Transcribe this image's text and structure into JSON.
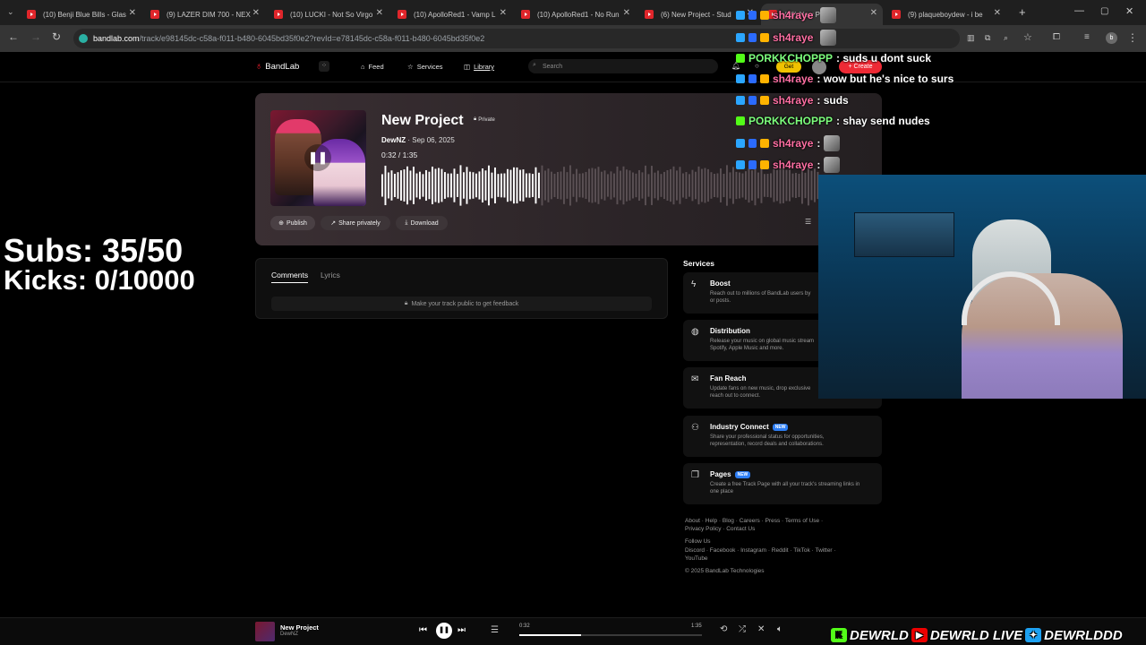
{
  "tabs": [
    {
      "label": "(10) Benji Blue Bills - Glas"
    },
    {
      "label": "(9) LAZER DIM 700 - NEX"
    },
    {
      "label": "(10) LUCKI - Not So Virgo"
    },
    {
      "label": "(10) ApolloRed1 - Vamp L"
    },
    {
      "label": "(10) ApolloRed1 - No Run"
    },
    {
      "label": "(6) New Project - Stud"
    },
    {
      "label": "(10) New Pro"
    },
    {
      "label": "(9) plaqueboydew - i be"
    }
  ],
  "address": {
    "domain": "bandlab.com",
    "path": "/track/e98145dc-c58a-f011-b480-6045bd35f0e2?revId=e78145dc-c58a-f011-b480-6045bd35f0e2"
  },
  "nav": {
    "logo": "BandLab",
    "feed": "Feed",
    "services": "Services",
    "library": "Library",
    "search_placeholder": "Search",
    "get": "Get",
    "create": "+ Create"
  },
  "track": {
    "title": "New Project",
    "privacy": "Private",
    "artist": "DewNZ",
    "date": "Sep 06, 2025",
    "time": "0:32 /  1:35",
    "progress": 0.34,
    "publish": "Publish",
    "share": "Share privately",
    "download": "Download"
  },
  "tabs_panel": {
    "comments": "Comments",
    "lyrics": "Lyrics",
    "notice": "Make your track public to get feedback"
  },
  "services": {
    "heading": "Services",
    "items": [
      {
        "title": "Boost",
        "desc": "Reach out to millions of BandLab users by",
        "desc2": "or posts.",
        "new": false,
        "icon": "bolt-icon"
      },
      {
        "title": "Distribution",
        "desc": "Release your music on global music stream",
        "desc2": "Spotify, Apple Music and more.",
        "new": false,
        "icon": "globe-icon"
      },
      {
        "title": "Fan Reach",
        "desc": "Update fans on new music, drop exclusive",
        "desc2": "reach out to connect.",
        "new": false,
        "icon": "mail-icon"
      },
      {
        "title": "Industry Connect",
        "desc": "Share your professional status for opportunities,",
        "desc2": "representation, record deals and collaborations.",
        "new": true,
        "icon": "people-icon"
      },
      {
        "title": "Pages",
        "desc": "Create a free Track Page with all your track's streaming links in",
        "desc2": "one place",
        "new": true,
        "icon": "pages-icon"
      }
    ],
    "new_label": "NEW"
  },
  "footer": {
    "links1": "About · Help · Blog · Careers · Press · Terms of Use ·",
    "links2": "Privacy Policy · Contact Us",
    "follow": "Follow Us",
    "social1": "Discord · Facebook · Instagram · Reddit · TikTok · Twitter ·",
    "social2": "YouTube",
    "copyright": "© 2025 BandLab Technologies"
  },
  "overlay": {
    "subs": "Subs: 35/50",
    "kicks": "Kicks: 0/10000"
  },
  "chat": [
    {
      "user": "sh4raye",
      "msg": "",
      "color": "#ff6fa3",
      "avatar": true
    },
    {
      "user": "sh4raye",
      "msg": "",
      "color": "#ff6fa3",
      "avatar": true
    },
    {
      "user": "PORKKCHOPPP",
      "msg": ": suds u dont suck",
      "color": "#7dff7d",
      "avatar": false
    },
    {
      "user": "sh4raye",
      "msg": ": wow but he's nice to surs",
      "color": "#ff6fa3",
      "avatar": false
    },
    {
      "user": "sh4raye",
      "msg": ": suds",
      "color": "#ff6fa3",
      "avatar": false
    },
    {
      "user": "PORKKCHOPPP",
      "msg": ": shay send nudes",
      "color": "#7dff7d",
      "avatar": false
    },
    {
      "user": "sh4raye",
      "msg": ":",
      "color": "#ff6fa3",
      "avatar": true
    },
    {
      "user": "sh4raye",
      "msg": ":",
      "color": "#ff6fa3",
      "avatar": true
    }
  ],
  "player": {
    "title": "New Project",
    "artist": "DewNZ",
    "elapsed": "0:32",
    "duration": "1:35",
    "progress": 0.34
  },
  "socials": [
    "DEWRLD",
    "DEWRLD LIVE",
    "DEWRLDDD"
  ]
}
